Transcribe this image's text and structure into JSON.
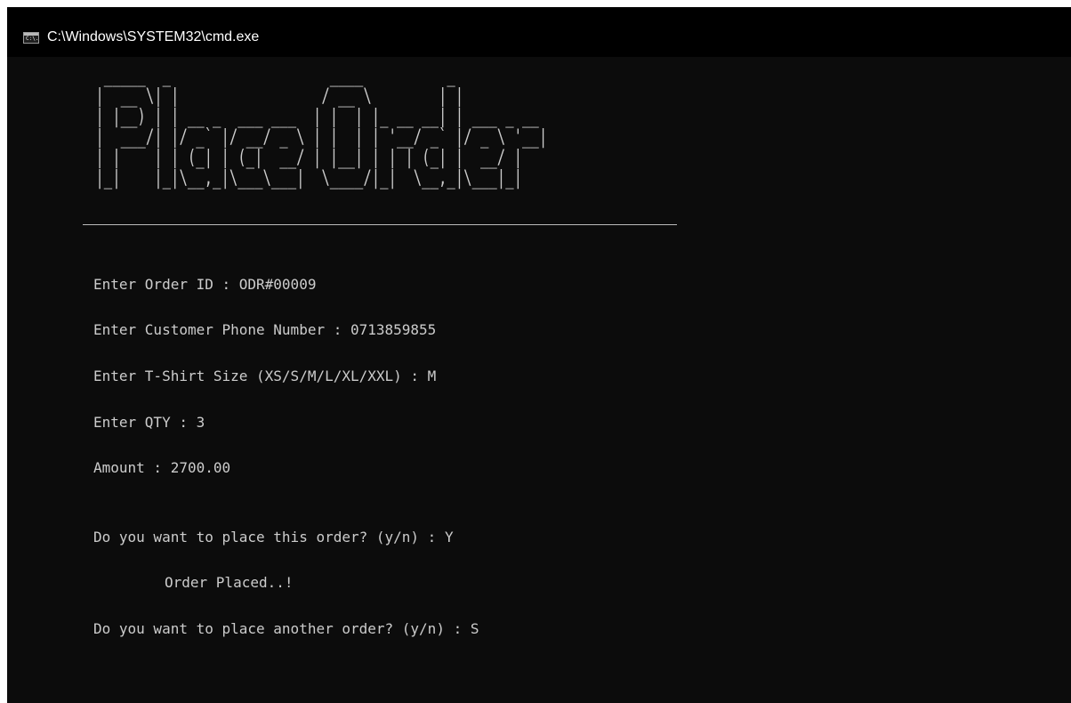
{
  "window": {
    "title": "C:\\Windows\\SYSTEM32\\cmd.exe",
    "icon": "cmd-console-icon",
    "icon_text": "C:\\."
  },
  "console": {
    "banner_lines": [
      "  _____  _                   ____          _           ",
      " |  __ \\| |                 / __ \\        | |          ",
      " | |__) | | __ _  ___ ___  | |  | |_ __ __| | ___ _ __ ",
      " |  ___/| |/ _` |/ __/ _ \\ | |  | | '__/ _` |/ _ \\ '__|",
      " | |    | | (_| | (_|  __/ | |__| | | | (_| |  __/ |   ",
      " |_|    |_|\\__,_|\\___\\___|  \\____/|_|  \\__,_|\\___|_|   "
    ],
    "lines": [
      "Enter Order ID : ODR#00009",
      "Enter Customer Phone Number : 0713859855",
      "Enter T-Shirt Size (XS/S/M/L/XL/XXL) : M",
      "Enter QTY : 3",
      "Amount : 2700.00",
      "Do you want to place this order? (y/n) : Y",
      "Order Placed..!",
      "Do you want to place another order? (y/n) : S"
    ]
  },
  "colors": {
    "console_background": "#0c0c0c",
    "titlebar_background": "#000000",
    "console_text": "#cccccc",
    "title_text": "#ffffff"
  }
}
